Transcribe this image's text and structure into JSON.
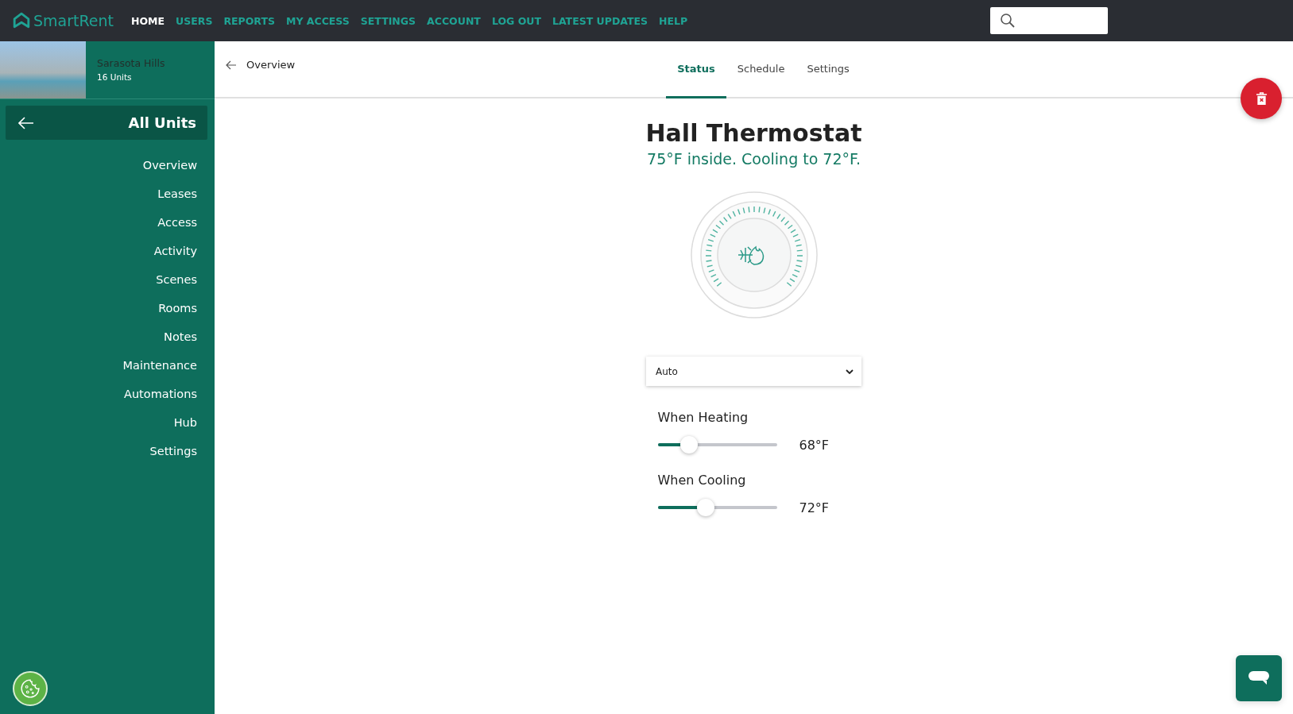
{
  "brand": "SmartRent",
  "nav": [
    {
      "label": "HOME",
      "selected": true
    },
    {
      "label": "USERS",
      "selected": false
    },
    {
      "label": "REPORTS",
      "selected": false
    },
    {
      "label": "MY ACCESS",
      "selected": false
    },
    {
      "label": "SETTINGS",
      "selected": false
    },
    {
      "label": "ACCOUNT",
      "selected": false
    },
    {
      "label": "LOG OUT",
      "selected": false
    },
    {
      "label": "LATEST UPDATES",
      "selected": false
    },
    {
      "label": "HELP",
      "selected": false
    }
  ],
  "property": {
    "name": "Sarasota Hills",
    "units": "16 Units"
  },
  "sidebar": {
    "title": "All Units",
    "items": [
      "Overview",
      "Leases",
      "Access",
      "Activity",
      "Scenes",
      "Rooms",
      "Notes",
      "Maintenance",
      "Automations",
      "Hub",
      "Settings"
    ]
  },
  "header": {
    "back": "Overview",
    "tabs": [
      {
        "label": "Status",
        "selected": true
      },
      {
        "label": "Schedule",
        "selected": false
      },
      {
        "label": "Settings",
        "selected": false
      }
    ]
  },
  "device": {
    "title": "Hall Thermostat",
    "status": "75°F inside. Cooling to 72°F.",
    "mode": "Auto"
  },
  "setpoints": [
    {
      "label": "When Heating",
      "level": 0.26,
      "reading": "68°F"
    },
    {
      "label": "When Cooling",
      "level": 0.4,
      "reading": "72°F"
    }
  ]
}
